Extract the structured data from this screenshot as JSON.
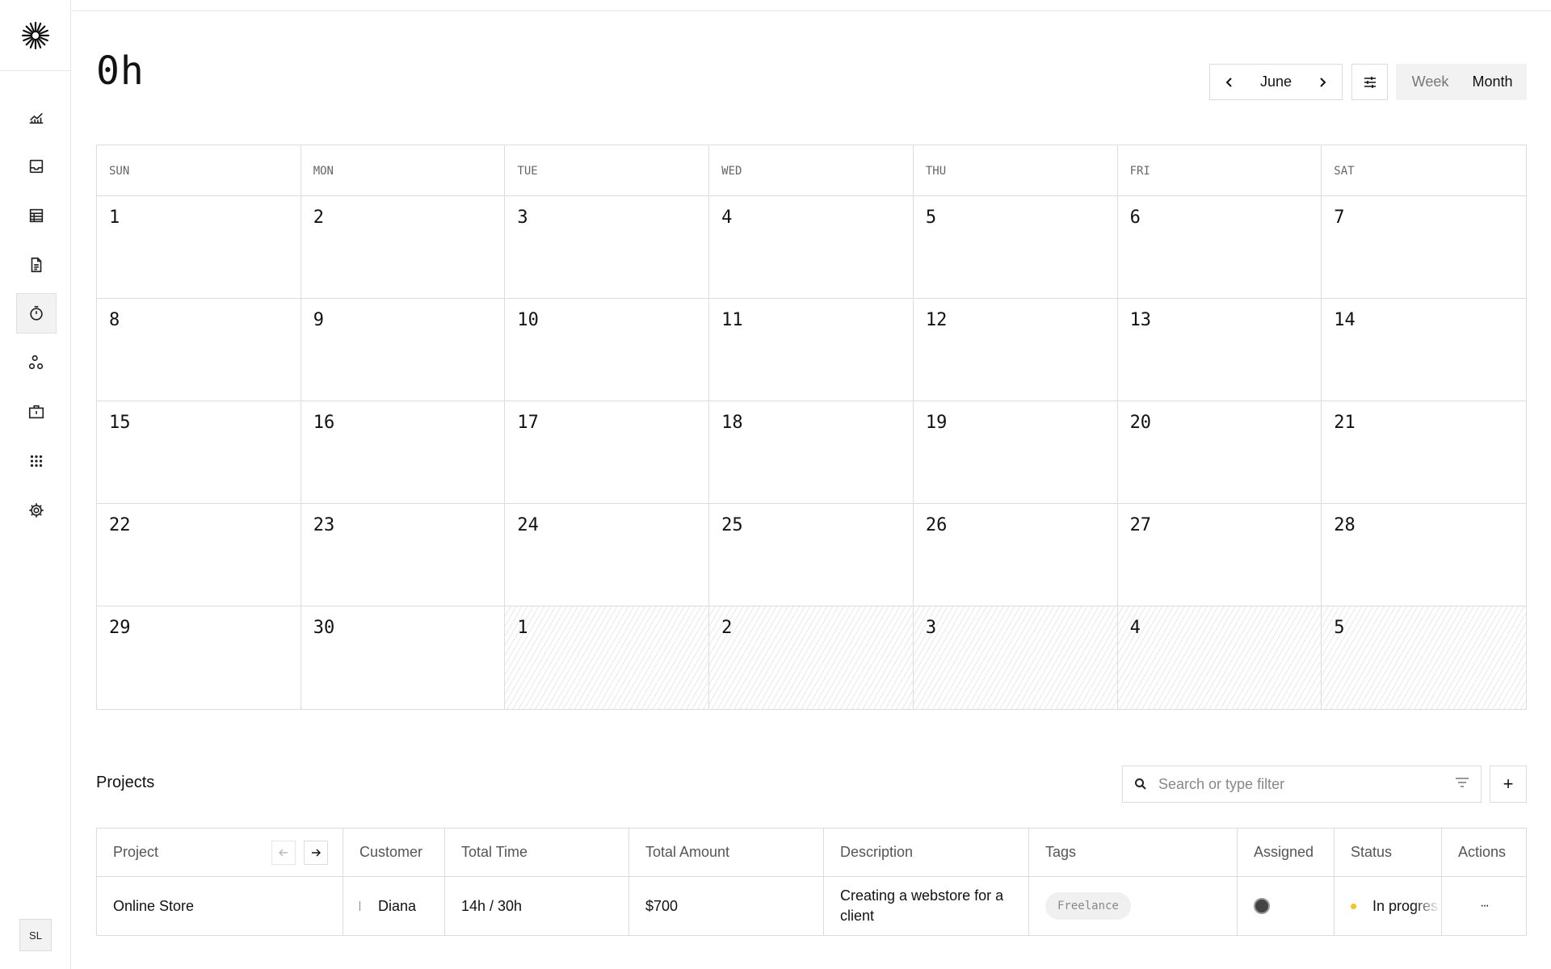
{
  "sidebar": {
    "logo": "sunburst-logo",
    "items": [
      {
        "icon": "chart-icon",
        "active": false
      },
      {
        "icon": "inbox-icon",
        "active": false
      },
      {
        "icon": "table-icon",
        "active": false
      },
      {
        "icon": "document-icon",
        "active": false
      },
      {
        "icon": "timer-icon",
        "active": true
      },
      {
        "icon": "customers-icon",
        "active": false
      },
      {
        "icon": "briefcase-icon",
        "active": false
      },
      {
        "icon": "apps-icon",
        "active": false
      },
      {
        "icon": "settings-icon",
        "active": false
      }
    ],
    "user_initials": "SL"
  },
  "tracker": {
    "total_time": "0h",
    "month": "June",
    "view_options": [
      "Week",
      "Month"
    ],
    "selected_view": "Month"
  },
  "calendar": {
    "weekdays": [
      "SUN",
      "MON",
      "TUE",
      "WED",
      "THU",
      "FRI",
      "SAT"
    ],
    "days": [
      "1",
      "2",
      "3",
      "4",
      "5",
      "6",
      "7",
      "8",
      "9",
      "10",
      "11",
      "12",
      "13",
      "14",
      "15",
      "16",
      "17",
      "18",
      "19",
      "20",
      "21",
      "22",
      "23",
      "24",
      "25",
      "26",
      "27",
      "28",
      "29",
      "30",
      "1",
      "2",
      "3",
      "4",
      "5"
    ]
  },
  "projects": {
    "title": "Projects",
    "search_placeholder": "Search or type filter",
    "add_label": "+",
    "columns": [
      "Project",
      "Customer",
      "Total Time",
      "Total Amount",
      "Description",
      "Tags",
      "Assigned",
      "Status",
      "Actions"
    ],
    "rows": [
      {
        "project": "Online Store",
        "customer": "Diana",
        "total_time": "14h / 30h",
        "total_amount": "$700",
        "description": "Creating a webstore for a client",
        "tag": "Freelance",
        "status": "In progress",
        "status_color": "#f5c518",
        "actions": "···"
      }
    ]
  }
}
